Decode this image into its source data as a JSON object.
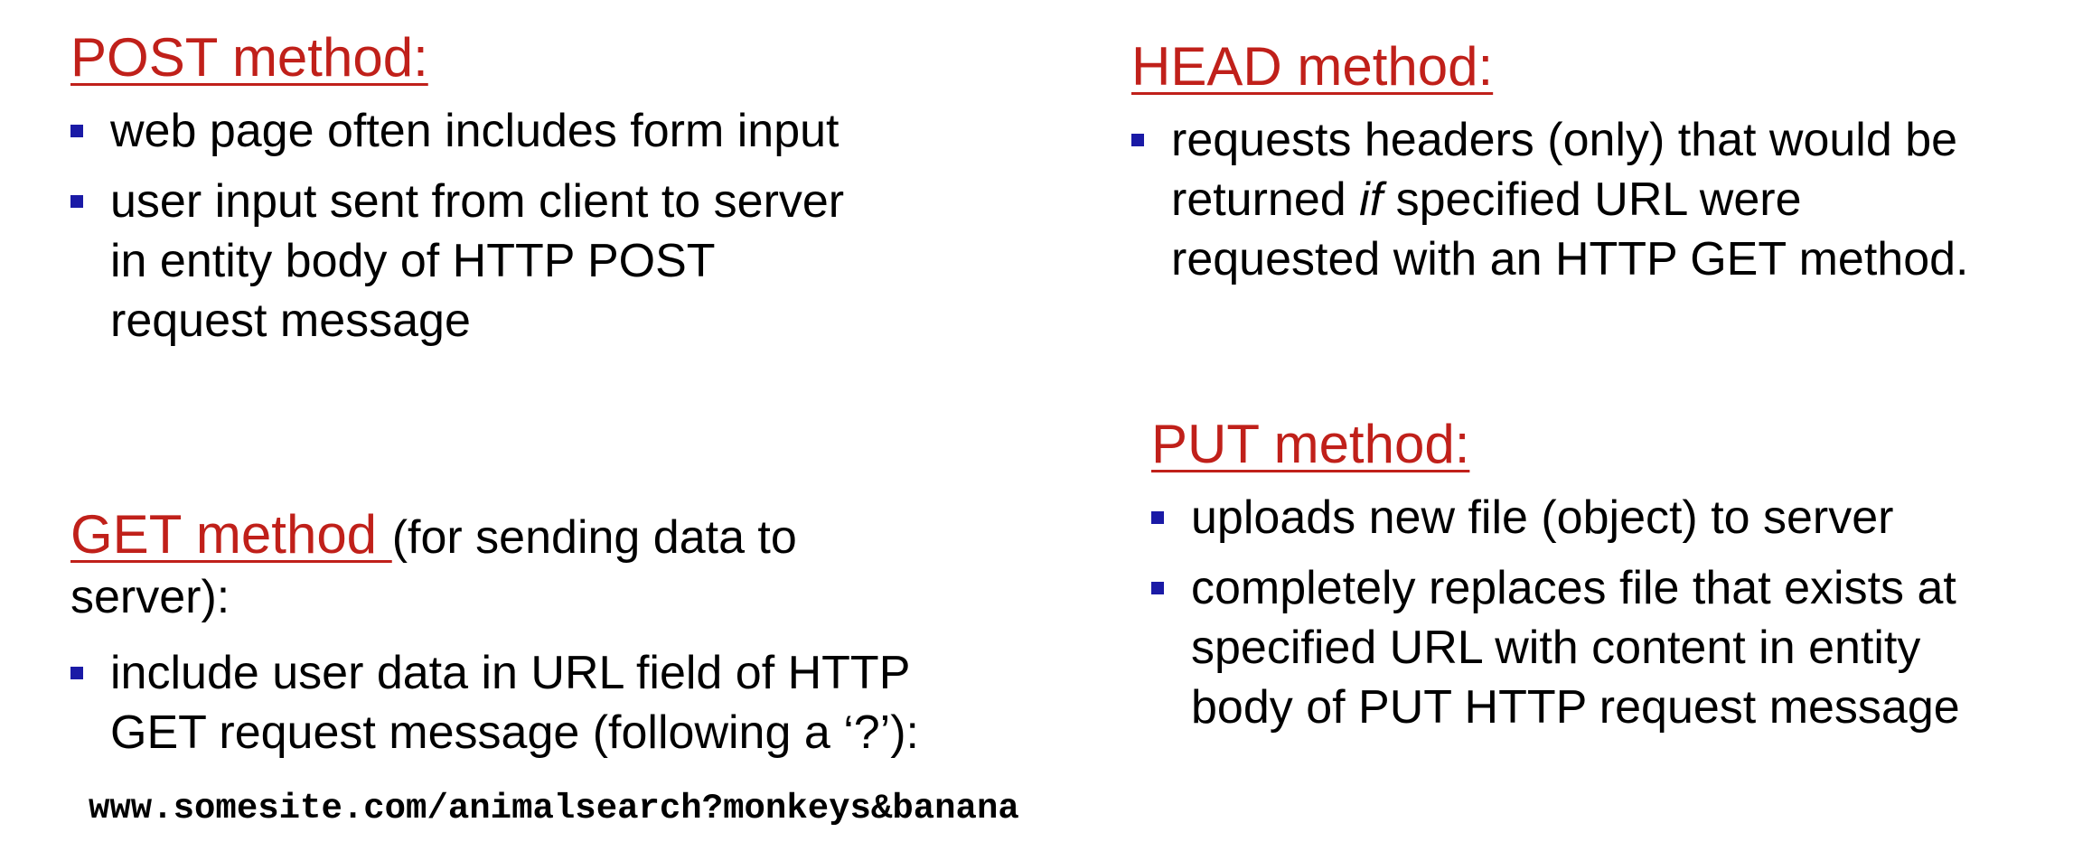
{
  "post": {
    "title": "POST method:",
    "bullets": [
      {
        "lines": [
          "web page often includes form input"
        ]
      },
      {
        "lines": [
          "user input sent from client to server",
          "in entity body of HTTP POST",
          "request message"
        ]
      }
    ]
  },
  "head": {
    "title": "HEAD method:",
    "bullet_lines": {
      "l1": "requests headers (only) that would be",
      "l2_pre": "returned ",
      "l2_em": "if",
      "l2_post": " specified URL were",
      "l3": "requested  with an HTTP GET method."
    }
  },
  "put": {
    "title": "PUT method:",
    "bullets": [
      {
        "lines": [
          "uploads new file (object) to server"
        ]
      },
      {
        "lines": [
          "completely replaces file that exists at",
          "specified URL with content in entity",
          "body of PUT HTTP request message"
        ]
      }
    ]
  },
  "get": {
    "title": "GET method ",
    "title_suffix": "(for sending data to",
    "title_cont": "server):",
    "bullets": [
      {
        "lines": [
          "include user data in URL field of HTTP",
          "GET request message (following a ‘?’):"
        ]
      }
    ],
    "url": "www.somesite.com/animalsearch?monkeys&banana"
  },
  "colors": {
    "heading": "#c0201a",
    "bullet_marker": "#1a1aa6",
    "text": "#000000"
  }
}
